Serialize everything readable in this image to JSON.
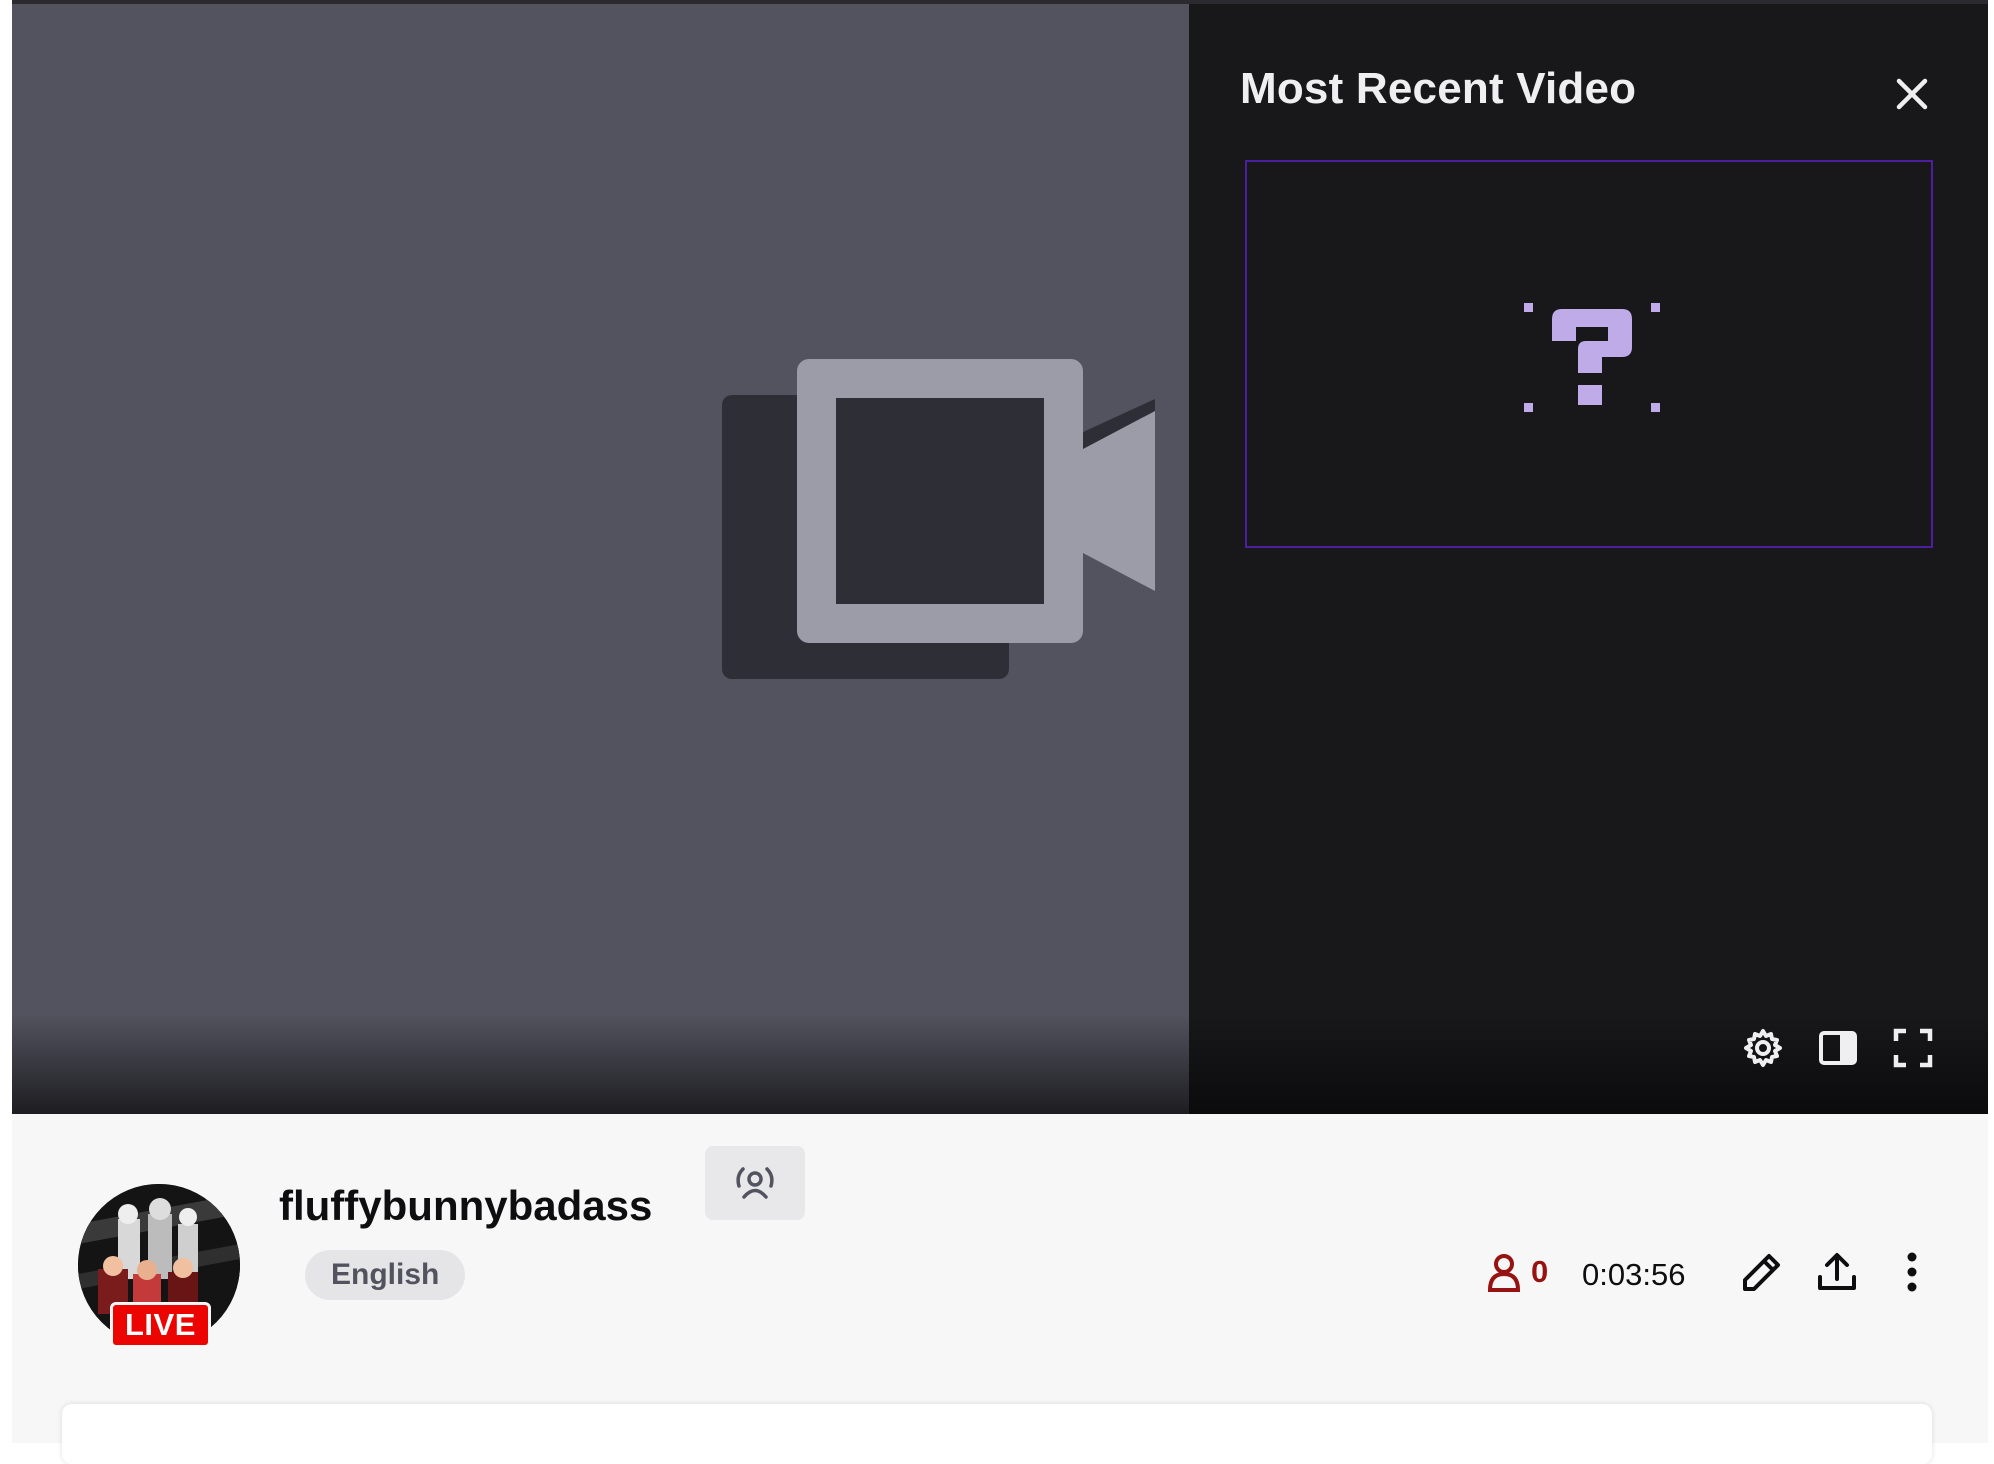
{
  "colors": {
    "player_bg": "#53535f",
    "panel_bg": "#18181b",
    "accent_purple": "#4b1f9e",
    "live_red": "#eb0400",
    "viewer_red": "#971311",
    "info_bg": "#f7f7f8"
  },
  "panel": {
    "title": "Most Recent Video",
    "close_icon": "close-icon",
    "thumbnail_icon": "question-mark-icon"
  },
  "player_controls": {
    "settings_icon": "gear-icon",
    "theatre_icon": "theatre-mode-icon",
    "fullscreen_icon": "fullscreen-icon"
  },
  "channel": {
    "name": "fluffybunnybadass",
    "live_badge": "LIVE",
    "language_tag": "English",
    "broadcast_icon": "broadcast-icon"
  },
  "stats": {
    "viewer_count": "0",
    "uptime": "0:03:56"
  },
  "actions": {
    "edit_icon": "pencil-icon",
    "share_icon": "share-icon",
    "more_icon": "more-vertical-icon"
  }
}
